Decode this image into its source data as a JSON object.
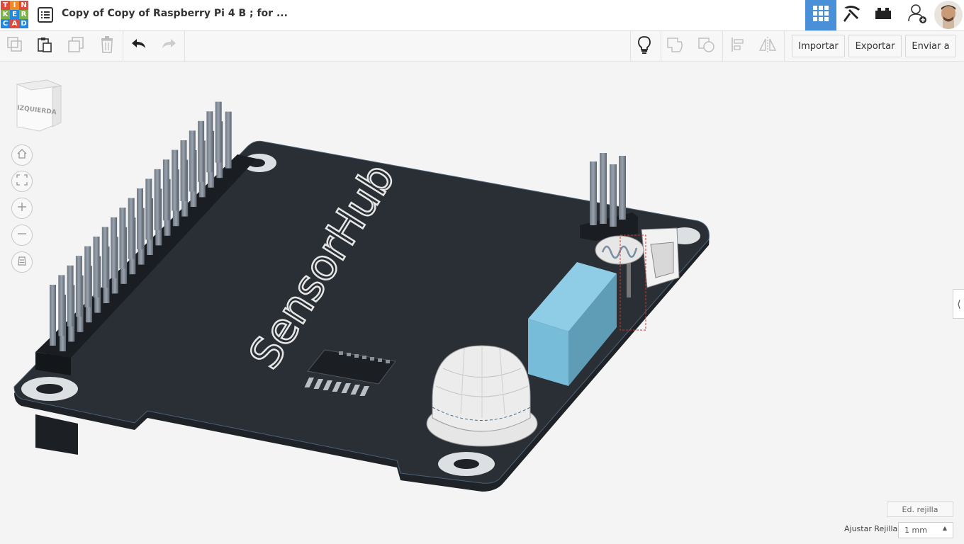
{
  "app": {
    "logo_letters": [
      "T",
      "I",
      "N",
      "K",
      "E",
      "R",
      "C",
      "A",
      "D"
    ],
    "logo_colors": [
      "#e2493d",
      "#ef8a2b",
      "#e2493d",
      "#7cb342",
      "#1e88e5",
      "#7cb342",
      "#1e88e5",
      "#e2493d",
      "#1e88e5"
    ],
    "title": "Copy of Copy of Raspberry Pi 4 B ; for ..."
  },
  "topbar": {
    "view_3d_icon": "grid-view-icon",
    "active_color": "#4a90d9"
  },
  "toolbar": {
    "import_label": "Importar",
    "export_label": "Exportar",
    "send_label": "Enviar a"
  },
  "viewcube": {
    "face_label": "IZQUIERDA"
  },
  "scene": {
    "board_text": "SensorHub"
  },
  "bottom": {
    "grid_edit_label": "Ed. rejilla",
    "snap_label": "Ajustar Rejilla",
    "snap_value": "1 mm"
  }
}
